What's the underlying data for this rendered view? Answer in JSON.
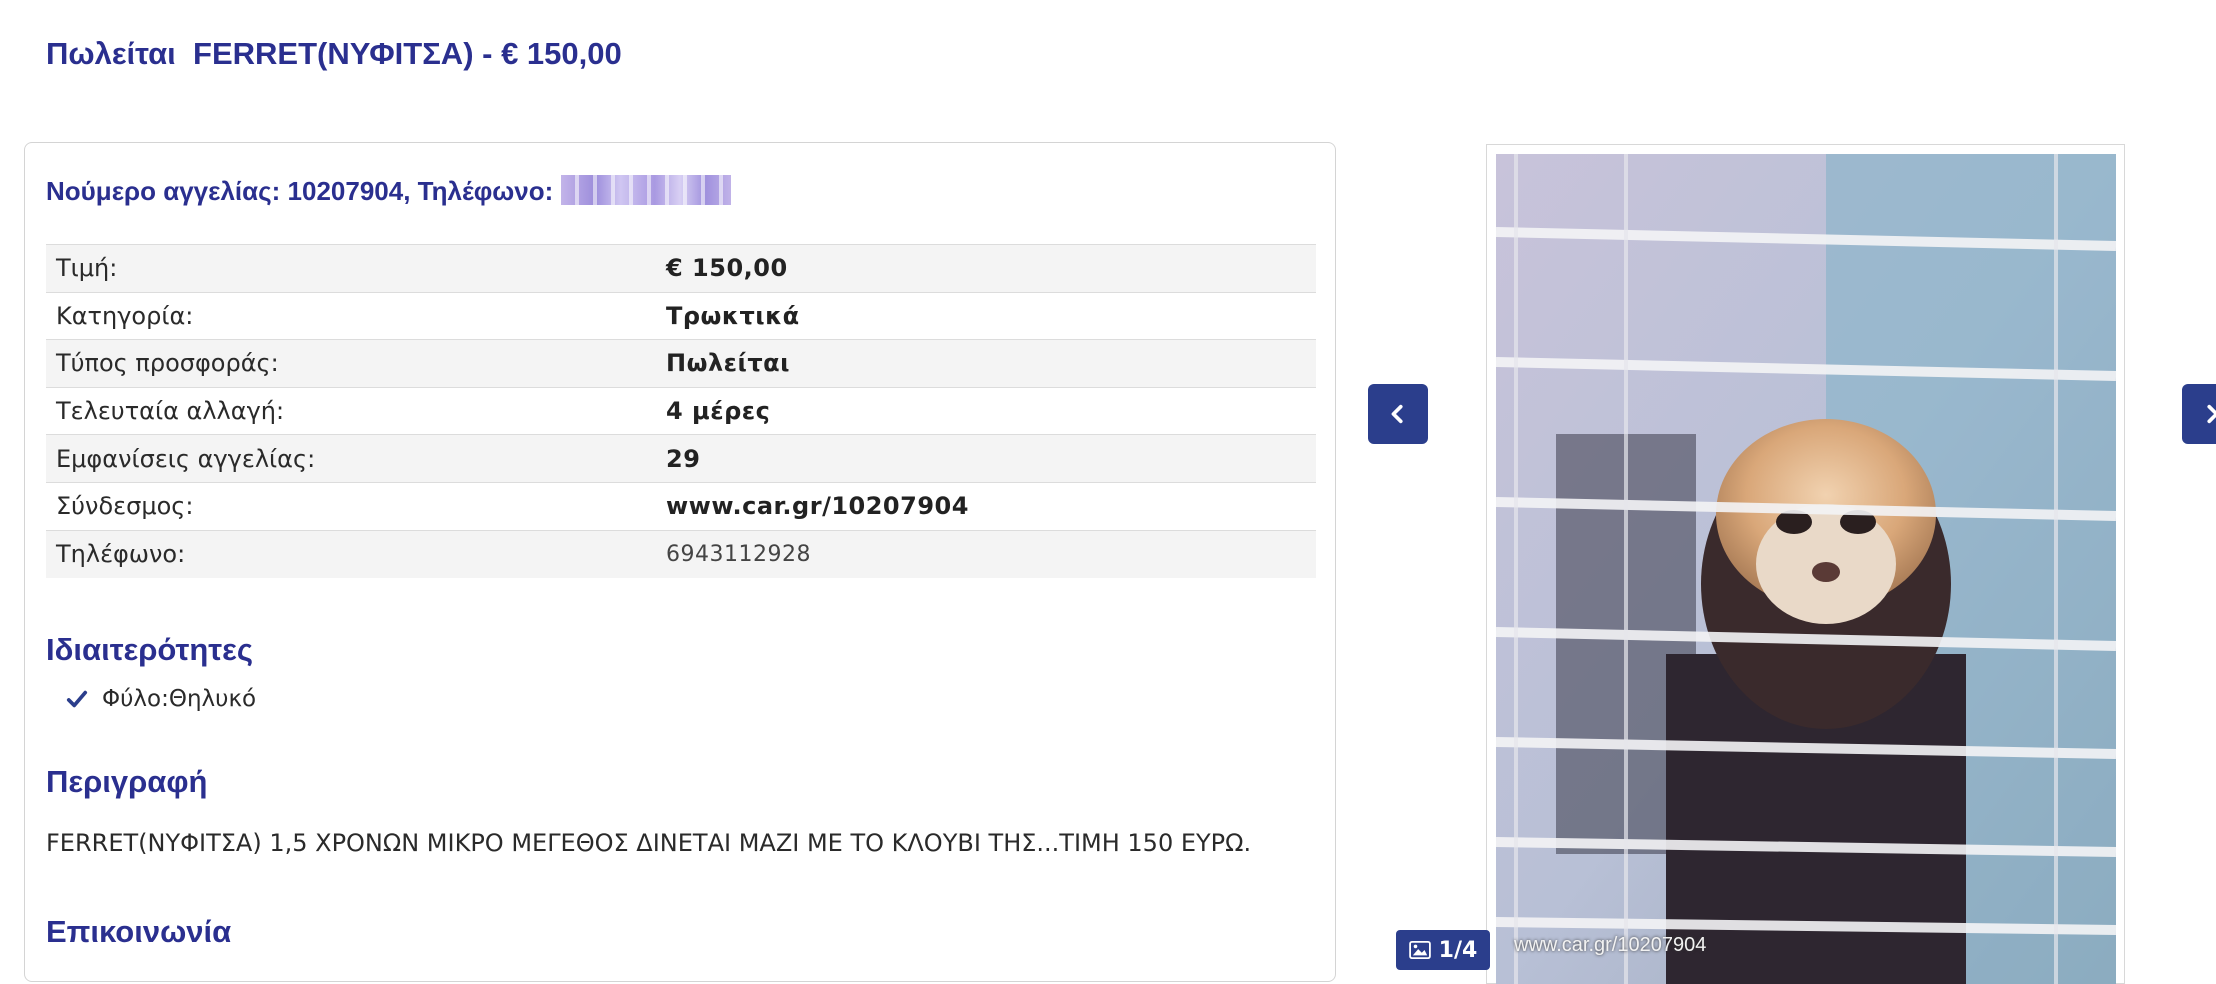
{
  "page_title": "Πωλείται  FERRET(ΝΥΦΙΤΣΑ) - € 150,00",
  "ad_header": "Νούμερο αγγελίας: 10207904, Τηλέφωνο:",
  "details": [
    {
      "label": "Τιμή:",
      "value": "€ 150,00"
    },
    {
      "label": "Κατηγορία:",
      "value": "Τρωκτικά"
    },
    {
      "label": "Τύπος προσφοράς:",
      "value": "Πωλείται"
    },
    {
      "label": "Τελευταία αλλαγή:",
      "value": "4 μέρες"
    },
    {
      "label": "Εμφανίσεις αγγελίας:",
      "value": "29"
    },
    {
      "label": "Σύνδεσμος:",
      "value": "www.car.gr/10207904"
    },
    {
      "label": "Τηλέφωνο:",
      "value": "6943112928"
    }
  ],
  "features_title": "Ιδιαιτερότητες",
  "features": [
    "Φύλο:Θηλυκό"
  ],
  "description_title": "Περιγραφή",
  "description": "FERRET(ΝΥΦΙΤΣΑ) 1,5 ΧΡΟΝΩΝ ΜΙΚΡΟ ΜΕΓΕΘΟΣ ΔΙΝΕΤΑΙ ΜΑΖΙ ΜΕ ΤΟ ΚΛΟΥΒΙ ΤΗΣ...ΤΙΜΗ 150 ΕΥΡΩ.",
  "contact_title": "Επικοινωνία",
  "gallery": {
    "counter": "1/4",
    "watermark": "www.car.gr/10207904",
    "prev_icon": "chevron-left-icon",
    "next_icon": "chevron-right-icon"
  },
  "colors": {
    "accent": "#2a2f8f",
    "button": "#2b3e8c"
  }
}
